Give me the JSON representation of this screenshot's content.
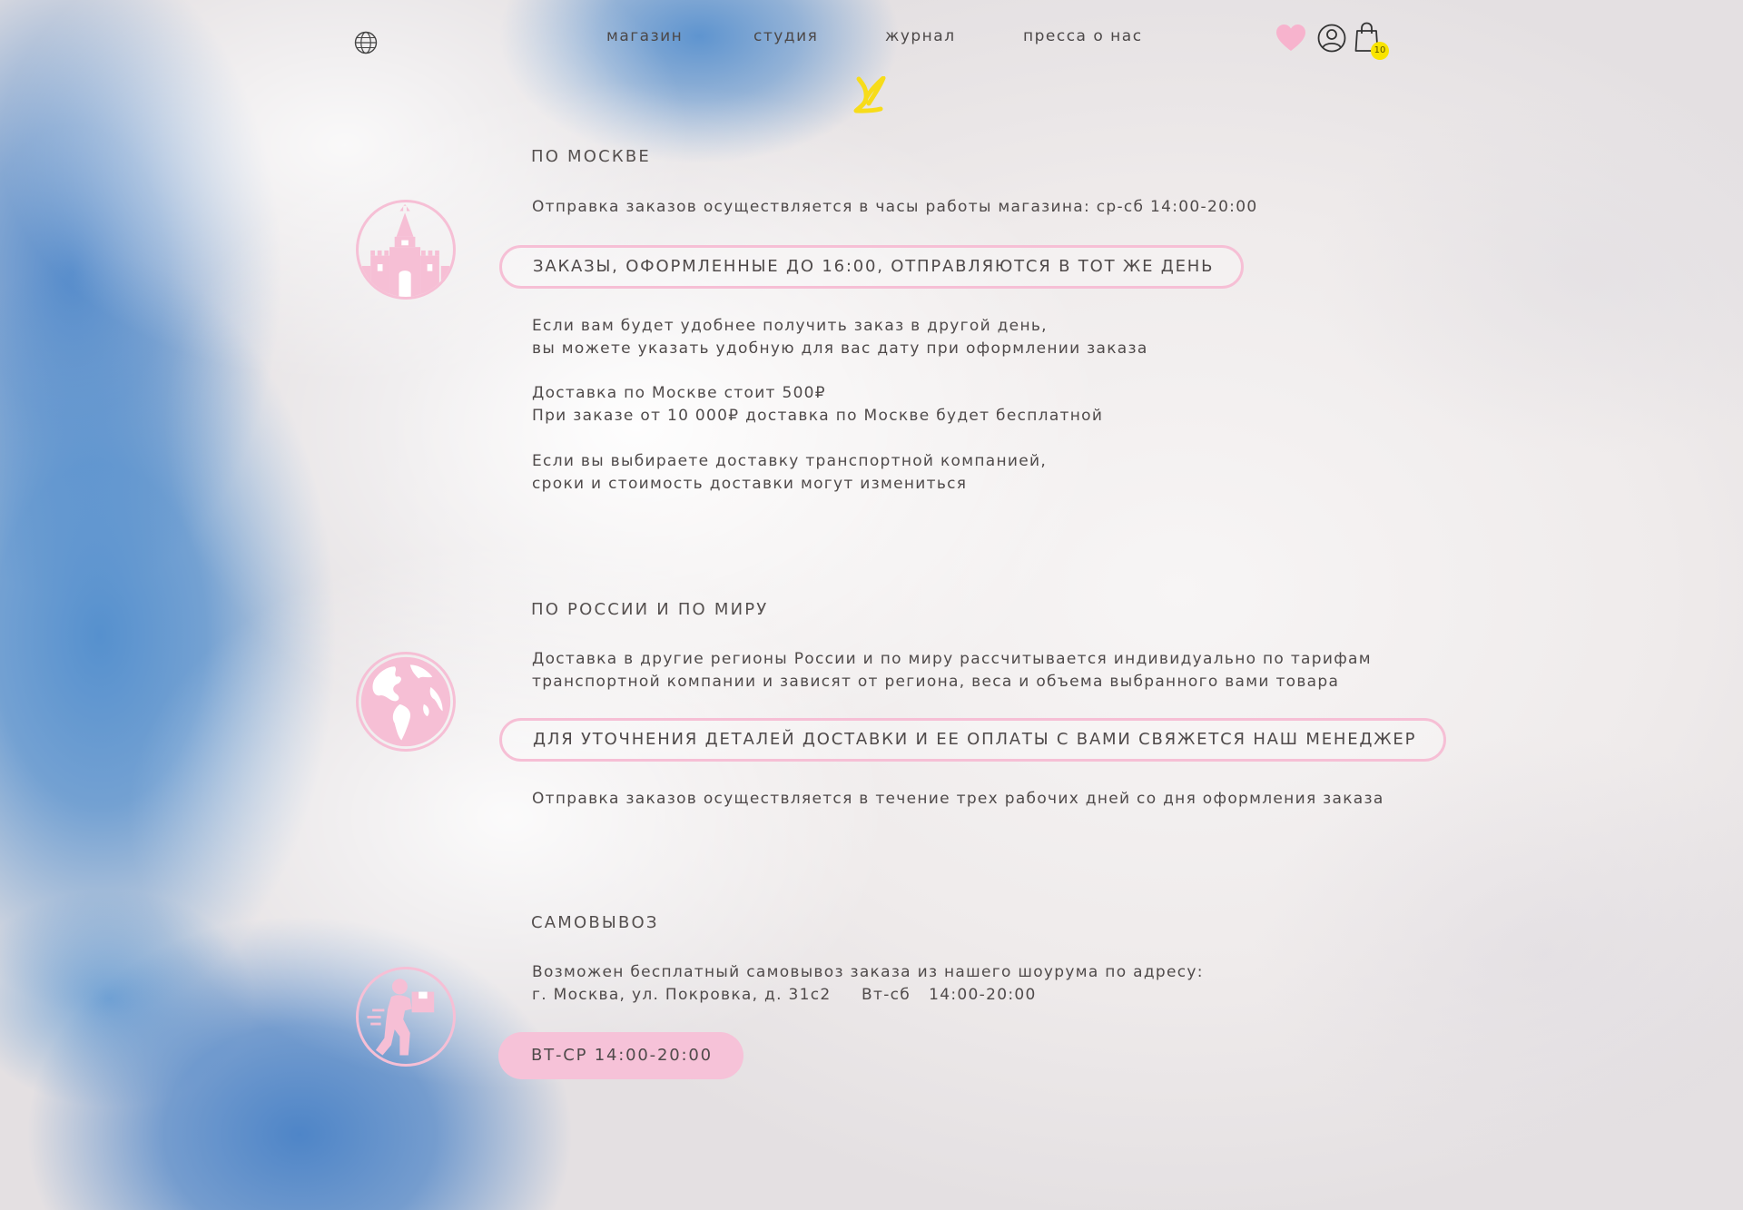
{
  "header": {
    "nav": [
      "магазин",
      "студия",
      "журнал",
      "пресса о нас"
    ],
    "cart_count": "10",
    "logo_text": "ℒ",
    "icons": [
      "globe-icon",
      "heart-icon",
      "user-icon",
      "bag-icon"
    ],
    "colors": {
      "accent_pink": "#f6bfd5",
      "logo_yellow": "#f7dc1a",
      "badge_yellow": "#f9e400"
    }
  },
  "sections": {
    "moscow": {
      "title": "ПО МОСКВЕ",
      "line1": "Отправка заказов осуществляется в часы работы магазина: ср-сб 14:00-20:00",
      "highlight": "ЗАКАЗЫ, ОФОРМЛЕННЫЕ ДО 16:00, ОТПРАВЛЯЮТСЯ В ТОТ ЖЕ ДЕНЬ",
      "para1": "Если вам будет удобнее получить заказ в другой день,\nвы можете указать удобную для вас дату при оформлении заказа",
      "para2": "Доставка по Москве стоит 500₽\nПри заказе от 10 000₽ доставка по Москве будет бесплатной",
      "para3": "Если вы выбираете доставку транспортной компанией,\nсроки и стоимость доставки могут измениться",
      "icon": "kremlin-tower-icon"
    },
    "russia": {
      "title": "ПО РОССИИ И ПО МИРУ",
      "line1": "Доставка в другие регионы России и по миру рассчитывается индивидуально по тарифам\nтранспортной компании и зависят от региона, веса и объема выбранного вами товара",
      "highlight": "ДЛЯ УТОЧНЕНИЯ ДЕТАЛЕЙ ДОСТАВКИ И ЕЕ ОПЛАТЫ С ВАМИ СВЯЖЕТСЯ НАШ МЕНЕДЖЕР",
      "para1": "Отправка заказов осуществляется в течение трех рабочих дней со дня оформления заказа",
      "icon": "earth-globe-icon"
    },
    "pickup": {
      "title": "САМОВЫВОЗ",
      "line1": "Возможен бесплатный самовывоз заказа из нашего шоурума по адресу:\nг. Москва, ул. Покровка, д. 31с2     Вт-сб   14:00-20:00",
      "button": "ВТ-СР  14:00-20:00",
      "icon": "courier-box-icon"
    }
  }
}
